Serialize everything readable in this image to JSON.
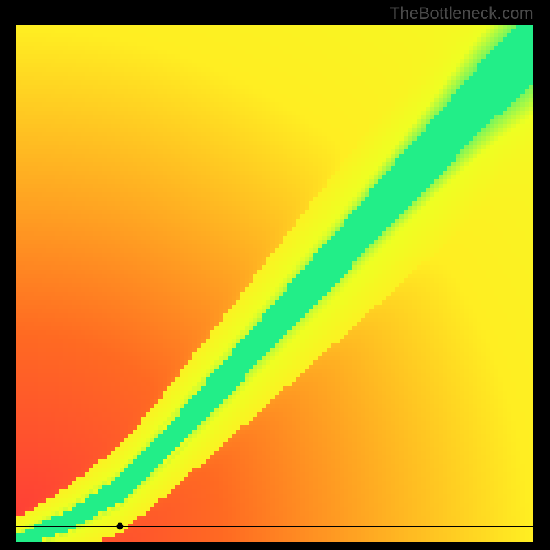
{
  "watermark": {
    "text": "TheBottleneck.com"
  },
  "chart_data": {
    "type": "heatmap",
    "title": "",
    "xlabel": "",
    "ylabel": "",
    "xlim": [
      0,
      100
    ],
    "ylim": [
      0,
      100
    ],
    "color_scale": {
      "0.0": "#ff2244",
      "0.25": "#ff6a22",
      "0.5": "#ffee22",
      "0.75": "#eeff22",
      "1.0": "#22ee88"
    },
    "optimal_band": {
      "description": "Green diagonal band where GPU-to-CPU performance ratio is balanced; curve bows slightly below the 45° line near the origin and broadens toward the top-right.",
      "center_line_points": [
        [
          0,
          0
        ],
        [
          10,
          4
        ],
        [
          20,
          10
        ],
        [
          30,
          20
        ],
        [
          40,
          31
        ],
        [
          50,
          42
        ],
        [
          60,
          53
        ],
        [
          70,
          64
        ],
        [
          80,
          75
        ],
        [
          90,
          86
        ],
        [
          100,
          96
        ]
      ],
      "band_halfwidth_start": 1.5,
      "band_halfwidth_end": 8
    },
    "marker": {
      "x": 20,
      "y": 3,
      "crosshair": true
    },
    "pixelation": 120
  }
}
